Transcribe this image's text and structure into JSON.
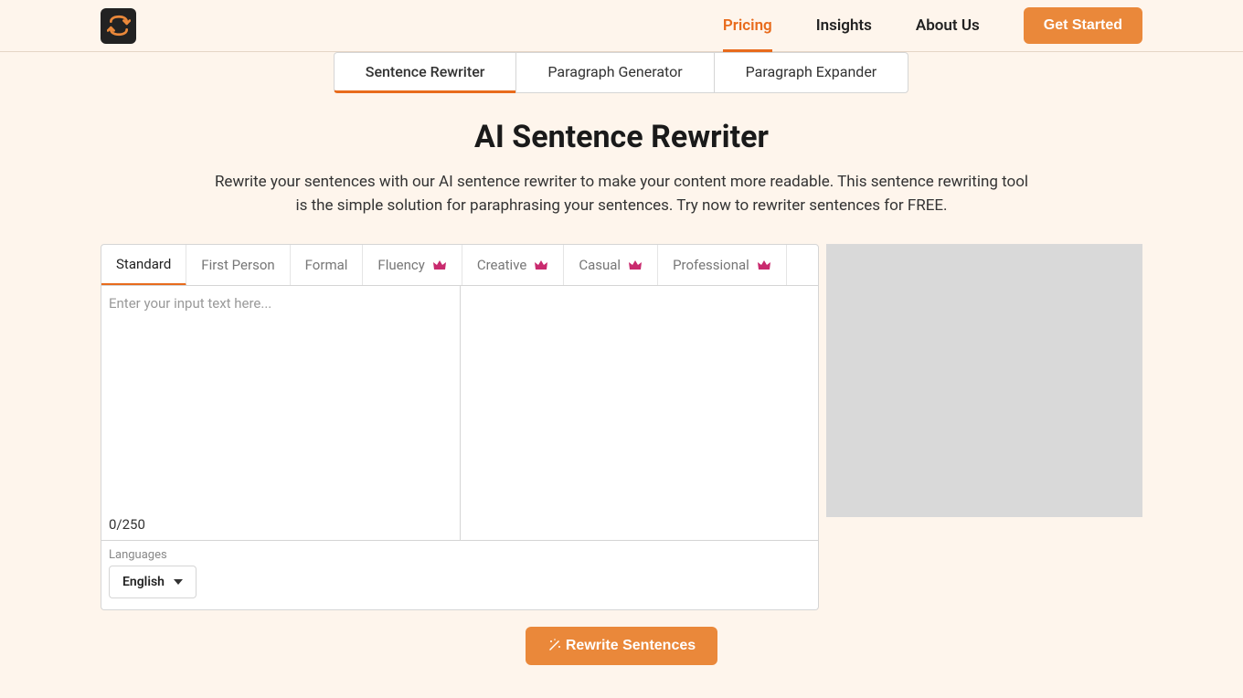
{
  "nav": {
    "links": [
      {
        "label": "Pricing",
        "active": true
      },
      {
        "label": "Insights",
        "active": false
      },
      {
        "label": "About Us",
        "active": false
      }
    ],
    "cta": "Get Started"
  },
  "tool_tabs": [
    {
      "label": "Sentence Rewriter",
      "active": true
    },
    {
      "label": "Paragraph Generator",
      "active": false
    },
    {
      "label": "Paragraph Expander",
      "active": false
    }
  ],
  "page_title": "AI Sentence Rewriter",
  "page_desc": "Rewrite your sentences with our AI sentence rewriter to make your content more readable. This sentence rewriting tool is the simple solution for paraphrasing your sentences. Try now to rewriter sentences for FREE.",
  "mode_tabs": [
    {
      "label": "Standard",
      "premium": false,
      "active": true
    },
    {
      "label": "First Person",
      "premium": false,
      "active": false
    },
    {
      "label": "Formal",
      "premium": false,
      "active": false
    },
    {
      "label": "Fluency",
      "premium": true,
      "active": false
    },
    {
      "label": "Creative",
      "premium": true,
      "active": false
    },
    {
      "label": "Casual",
      "premium": true,
      "active": false
    },
    {
      "label": "Professional",
      "premium": true,
      "active": false
    }
  ],
  "input": {
    "placeholder": "Enter your input text here...",
    "value": "",
    "char_count": "0/250"
  },
  "language": {
    "label": "Languages",
    "selected": "English"
  },
  "action": {
    "rewrite_label": "Rewrite Sentences"
  }
}
